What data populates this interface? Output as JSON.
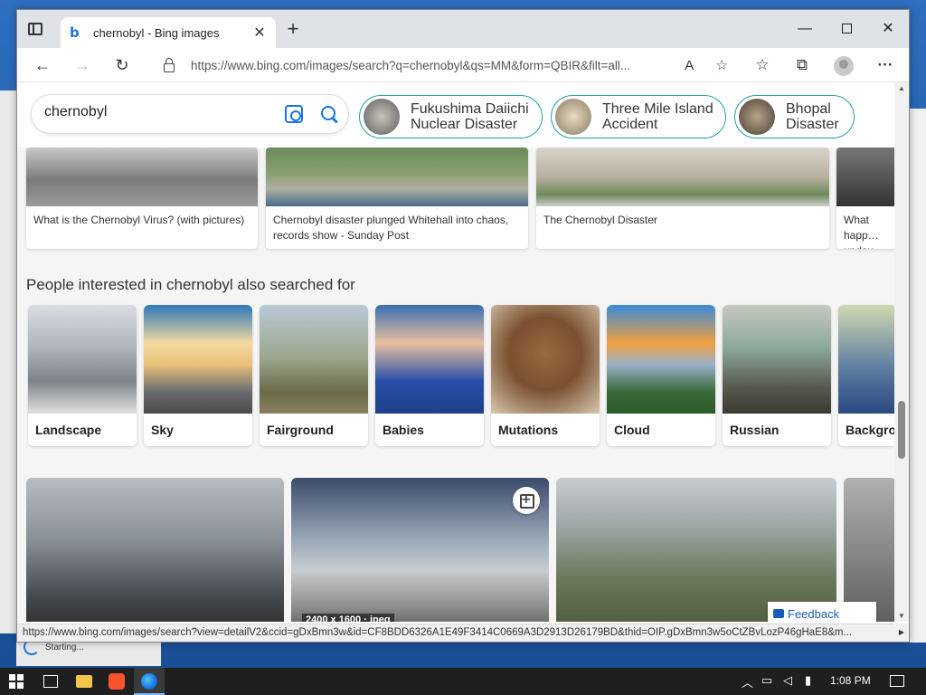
{
  "browser": {
    "tab_title": "chernobyl - Bing images",
    "url": "https://www.bing.com/images/search?q=chernobyl&qs=MM&form=QBIR&filt=all...",
    "status_url": "https://www.bing.com/images/search?view=detailV2&ccid=gDxBmn3w&id=CF8BDD6326A1E49F3414C0669A3D2913D26179BD&thid=OIP.gDxBmn3w5oCtZBvLozP46gHaE8&m..."
  },
  "search": {
    "query": "chernobyl",
    "chips": [
      {
        "label_line1": "Fukushima Daiichi",
        "label_line2": "Nuclear Disaster"
      },
      {
        "label_line1": "Three Mile Island",
        "label_line2": "Accident"
      },
      {
        "label_line1": "Bhopal",
        "label_line2": "Disaster"
      }
    ]
  },
  "results_top": [
    {
      "caption": "What is the Chernobyl Virus? (with pictures)"
    },
    {
      "caption": "Chernobyl disaster plunged Whitehall into chaos, records show - Sunday Post"
    },
    {
      "caption": "The Chernobyl Disaster"
    },
    {
      "caption": "What happ… upday New…"
    }
  ],
  "related": {
    "title": "People interested in chernobyl also searched for",
    "items": [
      {
        "label": "Landscape"
      },
      {
        "label": "Sky"
      },
      {
        "label": "Fairground"
      },
      {
        "label": "Babies"
      },
      {
        "label": "Mutations"
      },
      {
        "label": "Cloud"
      },
      {
        "label": "Russian"
      },
      {
        "label": "Backgrou…"
      }
    ]
  },
  "big_results": {
    "dims": "2400 x 1600 · jpeg"
  },
  "feedback_label": "Feedback",
  "desktop": {
    "starting_label": "Starting..."
  },
  "taskbar": {
    "time": "1:08 PM"
  }
}
